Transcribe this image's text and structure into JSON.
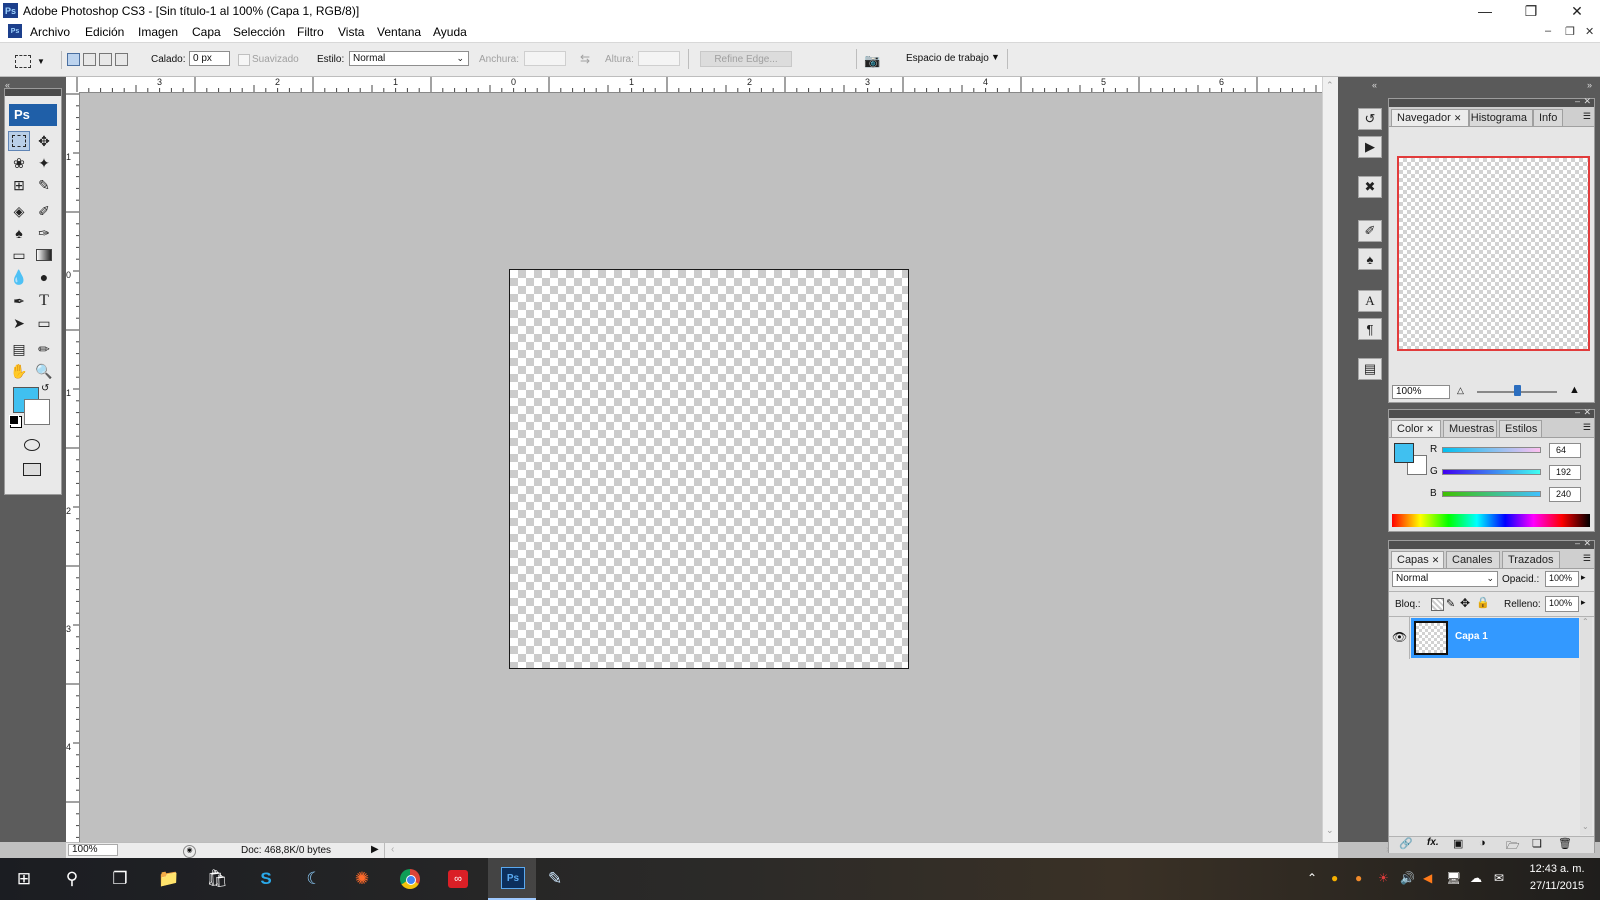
{
  "window": {
    "title": "Adobe Photoshop CS3 - [Sin título-1 al 100% (Capa 1, RGB/8)]",
    "app_icon": "Ps",
    "controls": [
      "minimize-icon",
      "restore-icon",
      "close-icon"
    ]
  },
  "menu": {
    "items": [
      "Archivo",
      "Edición",
      "Imagen",
      "Capa",
      "Selección",
      "Filtro",
      "Vista",
      "Ventana",
      "Ayuda"
    ]
  },
  "options": {
    "calado_label": "Calado:",
    "calado_value": "0 px",
    "suavizado_label": "Suavizado",
    "estilo_label": "Estilo:",
    "estilo_value": "Normal",
    "anchura_label": "Anchura:",
    "altura_label": "Altura:",
    "refine_label": "Refine Edge...",
    "workspace_label": "Espacio de trabajo"
  },
  "toolbox": {
    "logo": "Ps",
    "foreground_color": "#40c0f0",
    "background_color": "#ffffff"
  },
  "rulers": {
    "top": [
      "3",
      "2",
      "1",
      "0",
      "1",
      "2",
      "3",
      "4",
      "5",
      "6"
    ],
    "left": [
      "1",
      "0",
      "1",
      "2",
      "3",
      "4"
    ]
  },
  "status": {
    "zoom": "100%",
    "doc_info": "Doc: 468,8K/0 bytes"
  },
  "navigator": {
    "tabs": [
      "Navegador",
      "Histograma",
      "Info"
    ],
    "zoom": "100%",
    "zoom_level": 0.5
  },
  "color_panel": {
    "tabs": [
      "Color",
      "Muestras",
      "Estilos"
    ],
    "channels": [
      {
        "label": "R",
        "value": "64"
      },
      {
        "label": "G",
        "value": "192"
      },
      {
        "label": "B",
        "value": "240"
      }
    ],
    "swatch": "#40c0f0"
  },
  "layers_panel": {
    "tabs": [
      "Capas",
      "Canales",
      "Trazados"
    ],
    "blend_mode": "Normal",
    "opacity_label": "Opacid.:",
    "opacity_value": "100%",
    "lock_label": "Bloq.:",
    "fill_label": "Relleno:",
    "fill_value": "100%",
    "layers": [
      {
        "name": "Capa 1",
        "selected": true,
        "visible": true
      }
    ],
    "selected_color": "#3399ff"
  },
  "taskbar": {
    "time": "12:43 a. m.",
    "date": "27/11/2015",
    "apps": [
      "windows-start-icon",
      "search-icon",
      "task-view-icon",
      "file-explorer-icon",
      "store-icon",
      "skype-icon",
      "app-icon",
      "app-icon",
      "chrome-icon",
      "creative-cloud-icon",
      "photoshop-icon",
      "notepad-icon"
    ]
  }
}
